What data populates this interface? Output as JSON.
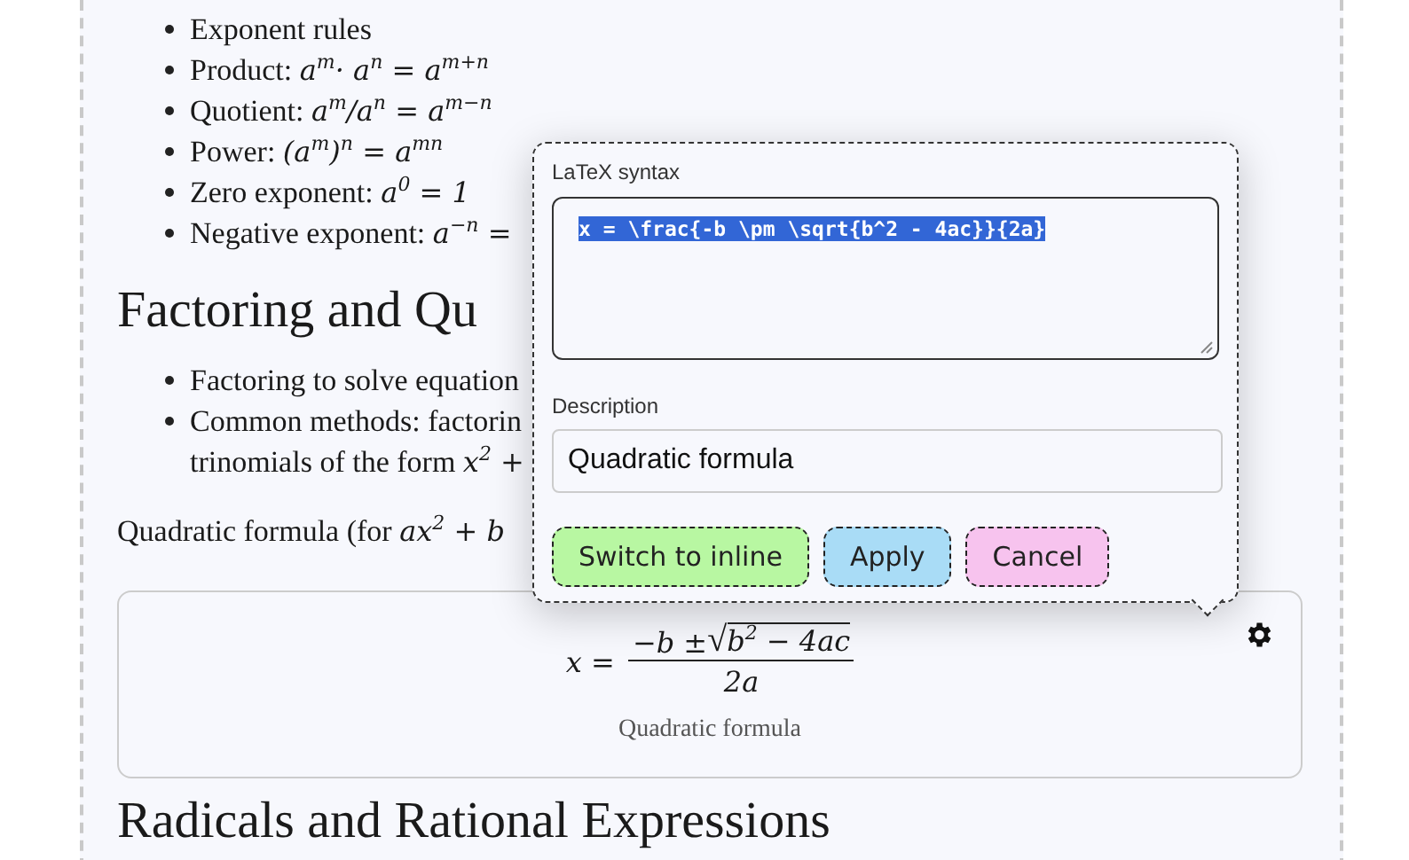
{
  "sections": [
    {
      "kind": "list",
      "items": [
        {
          "label": "Exponent rules"
        },
        {
          "label": "Product: ",
          "math": "a$^{m}$· a$^{n}$ = a$^{m+n}$"
        },
        {
          "label": "Quotient: ",
          "math": "a$^{m}$/a$^{n}$ = a$^{m−n}$"
        },
        {
          "label": "Power: ",
          "math": "(a$^{m}$)$^{n}$ = a$^{mn}$"
        },
        {
          "label": "Zero exponent: ",
          "math": "a$^{0}$ = 1"
        },
        {
          "label": "Negative exponent: ",
          "math": "a$^{−n}$ ="
        }
      ]
    },
    {
      "kind": "heading",
      "text": "Factoring and Qu"
    },
    {
      "kind": "list",
      "items": [
        {
          "label": "Factoring to solve equation"
        },
        {
          "label": "Common methods: factorin",
          "label2": "trinomials of the form ",
          "math": "x$^{2}$ +"
        }
      ]
    },
    {
      "kind": "paragraph",
      "label": "Quadratic formula (for ",
      "math": "ax$^{2}$ + b"
    },
    {
      "kind": "formula",
      "lhs": "x =",
      "numerator": "−b ±",
      "radical": "√",
      "radicand": "b$^{2}$ − 4ac",
      "denominator": "2a",
      "caption": "Quadratic formula"
    },
    {
      "kind": "heading",
      "text": "Radicals and Rational Expressions"
    }
  ],
  "editor": {
    "latex_label": "LaTeX syntax",
    "latex": {
      "value": "x = \\frac{-b \\pm \\sqrt{b^2 - 4ac}}{2a}",
      "selected": true
    },
    "description_label": "Description",
    "description": "Quadratic formula",
    "buttons": [
      {
        "label": "Switch to inline",
        "color": "#b8f7a2"
      },
      {
        "label": "Apply",
        "color": "#a9dcf6"
      },
      {
        "label": "Cancel",
        "color": "#f7c3ee"
      }
    ]
  }
}
